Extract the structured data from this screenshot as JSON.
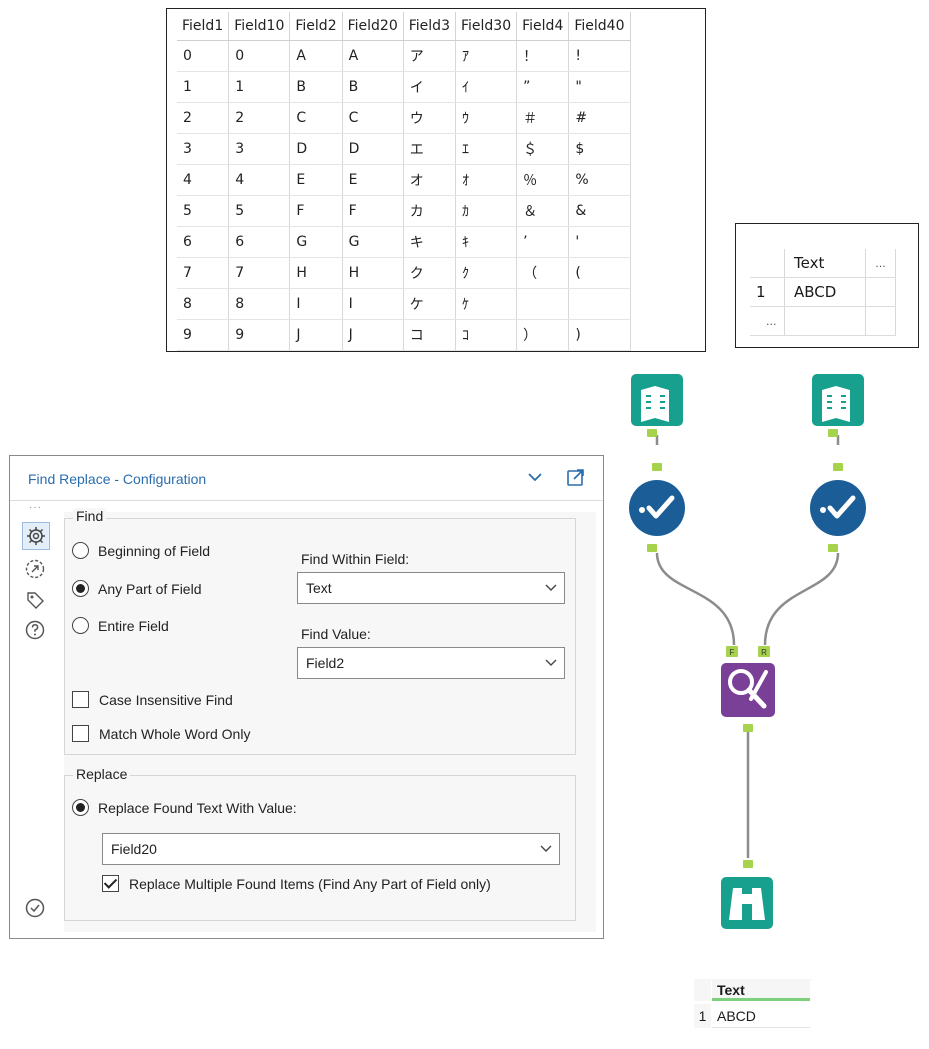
{
  "top_table": {
    "headers": [
      "Field1",
      "Field10",
      "Field2",
      "Field20",
      "Field3",
      "Field30",
      "Field4",
      "Field40"
    ],
    "rows": [
      [
        "0",
        "0",
        "A",
        "A",
        "ア",
        "ｱ",
        "！",
        "!"
      ],
      [
        "1",
        "1",
        "B",
        "B",
        "イ",
        "ｲ",
        "”",
        "\""
      ],
      [
        "2",
        "2",
        "C",
        "C",
        "ウ",
        "ｳ",
        "＃",
        "#"
      ],
      [
        "3",
        "3",
        "D",
        "D",
        "エ",
        "ｴ",
        "＄",
        "$"
      ],
      [
        "4",
        "4",
        "E",
        "E",
        "オ",
        "ｵ",
        "％",
        "%"
      ],
      [
        "5",
        "5",
        "F",
        "F",
        "カ",
        "ｶ",
        "＆",
        "&"
      ],
      [
        "6",
        "6",
        "G",
        "G",
        "キ",
        "ｷ",
        "’",
        "'"
      ],
      [
        "7",
        "7",
        "H",
        "H",
        "ク",
        "ｸ",
        "（",
        "("
      ],
      [
        "8",
        "8",
        "I",
        "I",
        "ケ",
        "ｹ",
        "",
        ""
      ],
      [
        "9",
        "9",
        "J",
        "J",
        "コ",
        "ｺ",
        "）",
        ")"
      ]
    ]
  },
  "text_table": {
    "header": "Text",
    "more": "...",
    "row_num": "1",
    "value": "ABCD",
    "footer_more": "..."
  },
  "config": {
    "title": "Find Replace - Configuration",
    "find_legend": "Find",
    "options": [
      "Beginning of Field",
      "Any Part of Field",
      "Entire Field"
    ],
    "selected_option": "Any Part of Field",
    "find_within_label": "Find Within Field:",
    "find_within_value": "Text",
    "find_value_label": "Find Value:",
    "find_value_value": "Field2",
    "case_insensitive": "Case Insensitive Find",
    "match_whole_word": "Match Whole Word Only",
    "replace_legend": "Replace",
    "replace_radio": "Replace Found Text With Value:",
    "replace_value": "Field20",
    "replace_multiple": "Replace Multiple Found Items (Find Any Part of Field only)",
    "replace_multiple_checked": true
  },
  "workflow": {
    "join_labels": [
      "F",
      "R"
    ],
    "colors": {
      "input": "#17a08d",
      "select": "#1b5e97",
      "find_replace": "#7a3f96",
      "browse": "#17a08d",
      "anchor": "#a7d24c",
      "wire": "#8c8c8c"
    }
  },
  "result": {
    "header": "Text",
    "row_num": "1",
    "value": "ABCD"
  }
}
